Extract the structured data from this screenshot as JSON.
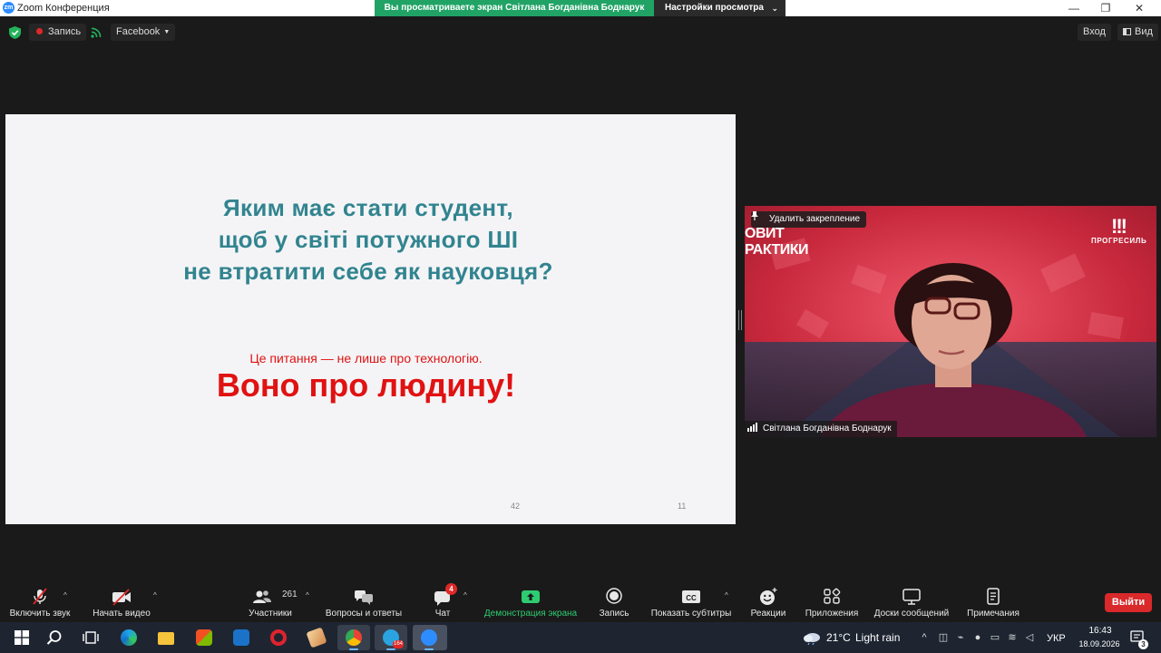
{
  "window": {
    "title": "Zoom Конференция",
    "share_banner": "Вы просматриваете экран Світлана Богданівна Боднарук",
    "view_options": "Настройки просмотра",
    "minimize": "—",
    "maximize": "❐",
    "close": "✕"
  },
  "topbar": {
    "recording_label": "Запись",
    "stream_label": "Facebook",
    "login_label": "Вход",
    "view_label": "Вид"
  },
  "slide": {
    "question_line1": "Яким має стати студент,",
    "question_line2": "щоб у світі потужного ШІ",
    "question_line3": "не втратити себе як науковця?",
    "subtitle": "Це питання — не лише про технологію.",
    "headline": "Воно про людину!",
    "page_number_a": "42",
    "page_number_b": "11"
  },
  "video": {
    "unpin_label": "Удалить закрепление",
    "participant_name": "Світлана Богданівна Боднарук",
    "brand_left_line1": "ОВИТ",
    "brand_left_line2": "РАКТИКИ",
    "brand_right_mark": "!!!",
    "brand_right_name": "ПРОГРЕСИЛЬ"
  },
  "toolbar": {
    "unmute": "Включить звук",
    "start_video": "Начать видео",
    "participants": "Участники",
    "participants_count": "261",
    "qa": "Вопросы и ответы",
    "chat": "Чат",
    "chat_badge": "4",
    "share_screen": "Демонстрация экрана",
    "record": "Запись",
    "captions": "Показать субтитры",
    "reactions": "Реакции",
    "apps": "Приложения",
    "whiteboards": "Доски сообщений",
    "notes": "Примечания",
    "leave": "Выйти",
    "colors": {
      "share_green": "#2ecc71",
      "leave_red": "#d9292b",
      "badge_red": "#e02828"
    }
  },
  "taskbar": {
    "telegram_badge": "164",
    "weather_temp": "21°C",
    "weather_desc": "Light rain",
    "language": "УКР",
    "time": "16:43",
    "date": "18.09.2026",
    "notification_count": "3",
    "apps": [
      "start-icon",
      "search-icon",
      "task-view-icon",
      "edge-icon",
      "file-explorer-icon",
      "store-icon",
      "mail-icon",
      "opera-icon",
      "inkscape-icon",
      "chrome-icon",
      "telegram-icon",
      "zoom-icon"
    ]
  }
}
